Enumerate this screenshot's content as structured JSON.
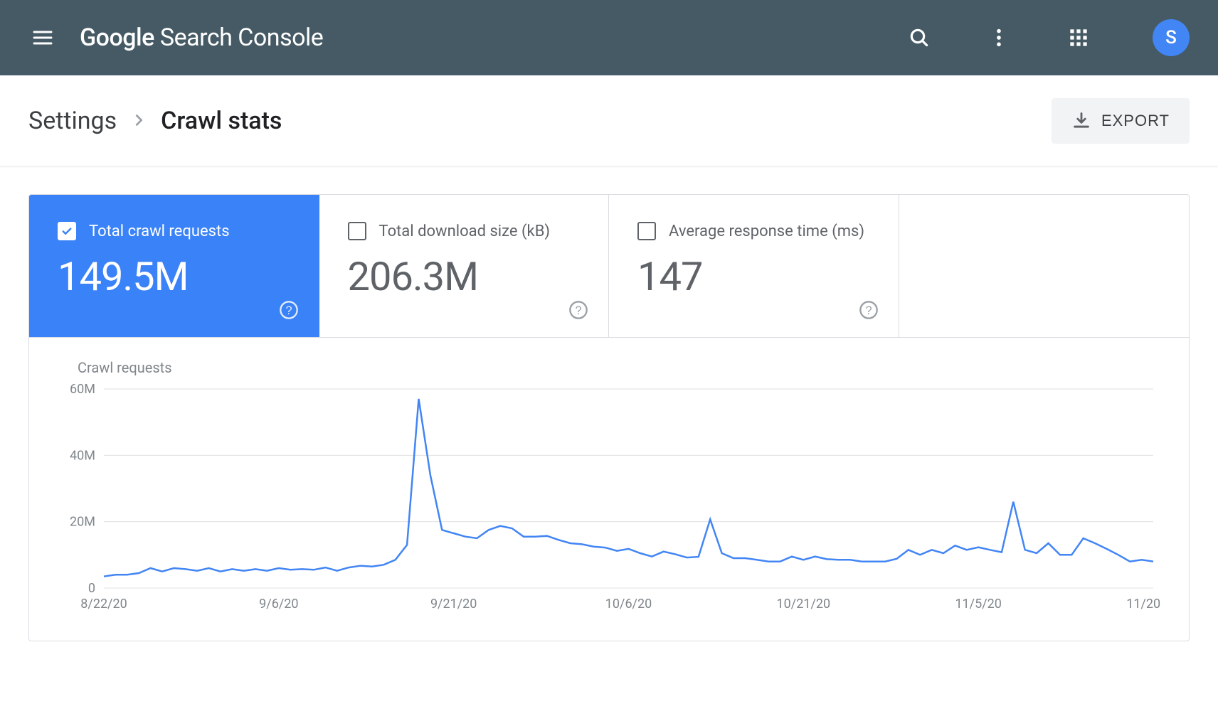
{
  "app": {
    "title": "Google Search Console",
    "google": "Google",
    "product": "Search Console"
  },
  "avatar_initial": "S",
  "breadcrumb": {
    "parent": "Settings",
    "current": "Crawl stats"
  },
  "export_label": "EXPORT",
  "metrics": [
    {
      "label": "Total crawl requests",
      "value": "149.5M",
      "active": true
    },
    {
      "label": "Total download size (kB)",
      "value": "206.3M",
      "active": false
    },
    {
      "label": "Average response time (ms)",
      "value": "147",
      "active": false
    }
  ],
  "chart_label": "Crawl requests",
  "chart_data": {
    "type": "line",
    "title": "Crawl requests",
    "xlabel": "",
    "ylabel": "",
    "ylim": [
      0,
      60000000
    ],
    "y_ticks": [
      "0",
      "20M",
      "40M",
      "60M"
    ],
    "x_tick_labels": [
      "8/22/20",
      "9/6/20",
      "9/21/20",
      "10/6/20",
      "10/21/20",
      "11/5/20",
      "11/20/20"
    ],
    "values": [
      3500000,
      4000000,
      4000000,
      4500000,
      6000000,
      5000000,
      6000000,
      5700000,
      5200000,
      6000000,
      5000000,
      5700000,
      5200000,
      5700000,
      5200000,
      6000000,
      5500000,
      5700000,
      5500000,
      6200000,
      5200000,
      6200000,
      6700000,
      6500000,
      7000000,
      8500000,
      13000000,
      57000000,
      34000000,
      17500000,
      16500000,
      15500000,
      15000000,
      17500000,
      18700000,
      18000000,
      15500000,
      15500000,
      15700000,
      14500000,
      13500000,
      13200000,
      12500000,
      12200000,
      11200000,
      11800000,
      10500000,
      9500000,
      11000000,
      10200000,
      9200000,
      9400000,
      20700000,
      10500000,
      9000000,
      9000000,
      8500000,
      8000000,
      8000000,
      9500000,
      8500000,
      9500000,
      8700000,
      8500000,
      8500000,
      8000000,
      8000000,
      8000000,
      8800000,
      11500000,
      10000000,
      11500000,
      10500000,
      12800000,
      11500000,
      12300000,
      11500000,
      10800000,
      26000000,
      11500000,
      10500000,
      13500000,
      10000000,
      10000000,
      15000000,
      13500000,
      11800000,
      10000000,
      8000000,
      8500000,
      8000000
    ]
  }
}
